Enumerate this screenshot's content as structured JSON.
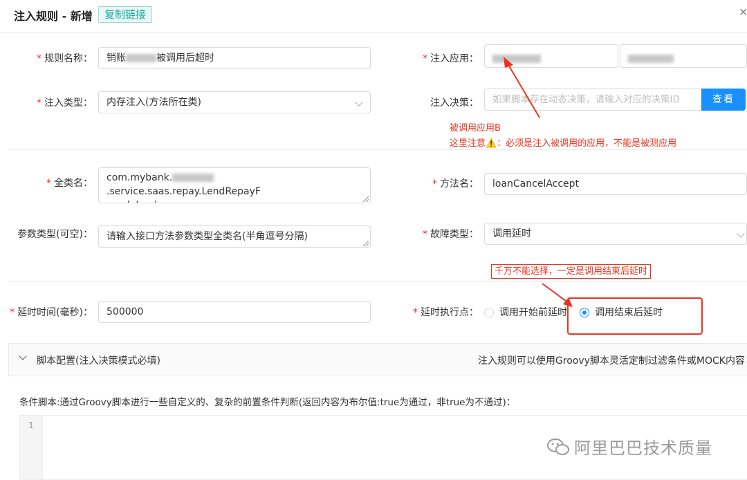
{
  "header": {
    "title": "注入规则 - 新增",
    "copy_link": "复制链接"
  },
  "form": {
    "rule_name": {
      "label": "规则名称",
      "value_prefix": "销账",
      "value_suffix": "调用后超时",
      "value_mid": "被"
    },
    "inject_app": {
      "label": "注入应用"
    },
    "inject_type": {
      "label": "注入类型",
      "value": "内存注入(方法所在类)"
    },
    "inject_decision": {
      "label": "注入决策",
      "placeholder": "如果脚本存在动态决策，请输入对应的决策ID",
      "button": "查看"
    },
    "class_name": {
      "label": "全类名",
      "line1_prefix": "com.mybank.",
      "line1_suffix": ".service.saas.repay.LendRepayF",
      "line2": "acadeImpl"
    },
    "method_name": {
      "label": "方法名",
      "value": "loanCancelAccept"
    },
    "param_type": {
      "label": "参数类型(可空)",
      "placeholder": "请输入接口方法参数类型全类名(半角逗号分隔)"
    },
    "fault_type": {
      "label": "故障类型",
      "value": "调用延时"
    },
    "delay_time": {
      "label": "延时时间(毫秒)",
      "value": "500000"
    },
    "delay_point": {
      "label": "延时执行点",
      "option_before": "调用开始前延时",
      "option_after": "调用结束后延时",
      "selected": "after"
    }
  },
  "annotations": {
    "note_line1": "被调用应用B",
    "note_line2": "这里注意⚠️：必须是注入被调用的应用，不能是被测应用",
    "callout": "千万不能选择，一定是调用结束后延时"
  },
  "script_panel": {
    "title": "脚本配置(注入决策模式必填)",
    "hint": "注入规则可以使用Groovy脚本灵活定制过滤条件或MOCK内容",
    "condition_label": "条件脚本:通过Groovy脚本进行一些自定义的、复杂的前置条件判断(返回内容为布尔值:true为通过，非true为不通过)：",
    "line_number": "1"
  },
  "watermark": {
    "text": "阿里巴巴技术质量"
  },
  "colors": {
    "primary": "#1890ff",
    "required": "#f5222d",
    "annotation": "#e8341f",
    "tag": "#13a89e"
  }
}
